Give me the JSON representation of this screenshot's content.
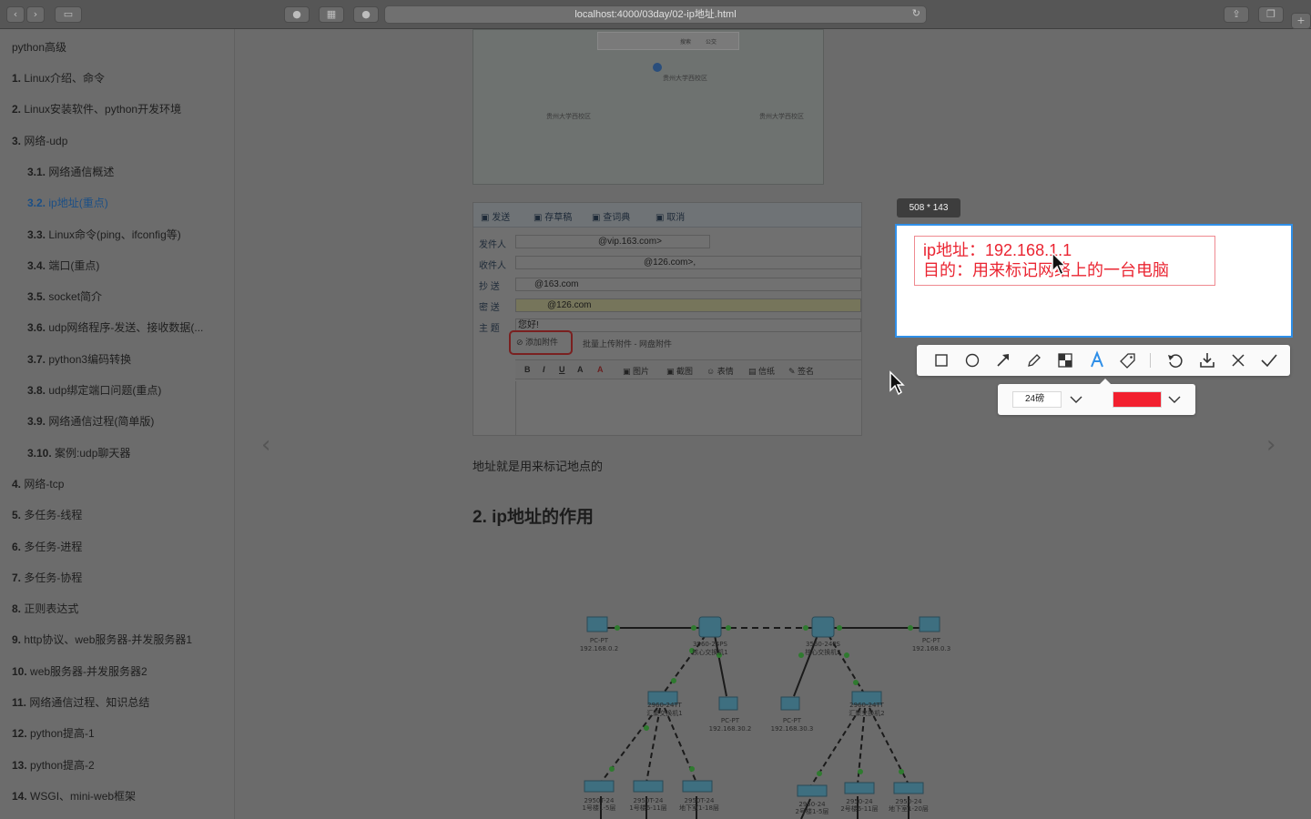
{
  "browser": {
    "url": "localhost:4000/03day/02-ip地址.html",
    "icons": [
      "back-icon",
      "forward-icon",
      "sidebar-icon",
      "extension-icons",
      "reader-icon",
      "reload-icon",
      "share-icon",
      "tabs-icon",
      "new-tab-icon"
    ]
  },
  "sidebar": {
    "title": "python高级",
    "items": [
      {
        "num": "1.",
        "label": "Linux介绍、命令"
      },
      {
        "num": "2.",
        "label": "Linux安装软件、python开发环境"
      },
      {
        "num": "3.",
        "label": "网络-udp"
      },
      {
        "num": "3.1.",
        "label": "网络通信概述"
      },
      {
        "num": "3.2.",
        "label": "ip地址(重点)"
      },
      {
        "num": "3.3.",
        "label": "Linux命令(ping、ifconfig等)"
      },
      {
        "num": "3.4.",
        "label": "端口(重点)"
      },
      {
        "num": "3.5.",
        "label": "socket简介"
      },
      {
        "num": "3.6.",
        "label": "udp网络程序-发送、接收数据(..."
      },
      {
        "num": "3.7.",
        "label": "python3编码转换"
      },
      {
        "num": "3.8.",
        "label": "udp绑定端口问题(重点)"
      },
      {
        "num": "3.9.",
        "label": "网络通信过程(简单版)"
      },
      {
        "num": "3.10.",
        "label": "案例:udp聊天器"
      },
      {
        "num": "4.",
        "label": "网络-tcp"
      },
      {
        "num": "5.",
        "label": "多任务-线程"
      },
      {
        "num": "6.",
        "label": "多任务-进程"
      },
      {
        "num": "7.",
        "label": "多任务-协程"
      },
      {
        "num": "8.",
        "label": "正则表达式"
      },
      {
        "num": "9.",
        "label": "http协议、web服务器-并发服务器1"
      },
      {
        "num": "10.",
        "label": "web服务器-并发服务器2"
      },
      {
        "num": "11.",
        "label": "网络通信过程、知识总结"
      },
      {
        "num": "12.",
        "label": "python提高-1"
      },
      {
        "num": "13.",
        "label": "python提高-2"
      },
      {
        "num": "14.",
        "label": "WSGI、mini-web框架"
      }
    ]
  },
  "map": {
    "labels": [
      "贵州大学西校区",
      "贵州大学西校区",
      "贵州大学西校区"
    ],
    "search_btn1": "搜索",
    "search_btn2": "公交"
  },
  "mail": {
    "toolbar": [
      "发送",
      "存草稿",
      "查词典",
      "取消"
    ],
    "from_label": "发件人",
    "from_value": "@vip.163.com>",
    "to_label": "收件人",
    "to_value": "@126.com>,",
    "cc_label": "抄 送",
    "cc_value": "@163.com",
    "bcc_label": "密 送",
    "bcc_value": "@126.com",
    "subject_label": "主 题",
    "subject_value": "您好!",
    "attach": "添加附件",
    "attach_more": "批量上传附件 - 网盘附件",
    "editor_tools": [
      "B",
      "I",
      "U",
      "A",
      "A",
      "图片",
      "截图",
      "表情",
      "信纸",
      "签名"
    ]
  },
  "content": {
    "paragraph": "地址就是用来标记地点的",
    "heading": "2. ip地址的作用"
  },
  "network": {
    "nodes": [
      "PC-PT",
      "192.168.0.2",
      "3560-24PS",
      "核心交换机1",
      "3560-24PS",
      "核心交换机2",
      "PC-PT",
      "192.168.0.3",
      "2960-24TT",
      "汇聚交换机1",
      "PC-PT",
      "192.168.30.2",
      "PC-PT",
      "192.168.30.3",
      "2960-24TT",
      "汇聚交换机2",
      "2950T-24",
      "1号楼1-5层",
      "2950T-24",
      "1号楼6-11层",
      "2950T-24",
      "地下室1-18层",
      "2950-24",
      "2号楼1-5层",
      "2950-24",
      "2号楼6-11层",
      "2950-24",
      "地下室1-20层"
    ]
  },
  "capture": {
    "size": "508 * 143",
    "line1": "ip地址：192.168.1.1",
    "line2": "目的：用来标记网络上的一台电脑",
    "tools": [
      "rectangle-icon",
      "ellipse-icon",
      "arrow-icon",
      "pen-icon",
      "mosaic-icon",
      "text-icon",
      "tag-icon",
      "undo-icon",
      "download-icon",
      "close-icon",
      "confirm-icon"
    ],
    "font_size": "24磅",
    "color": "#f2202f"
  }
}
